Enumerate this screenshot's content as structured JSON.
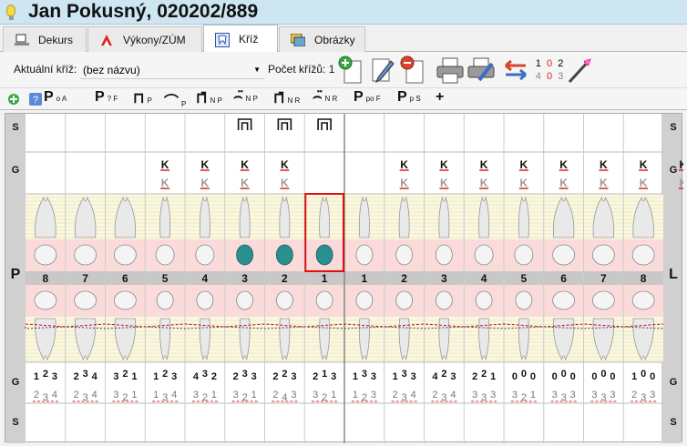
{
  "window": {
    "title": "Jan Pokusný, 020202/889"
  },
  "tabs": [
    {
      "label": "Dekurs",
      "icon": "monitor-icon",
      "active": false
    },
    {
      "label": "Výkony/ZÚM",
      "icon": "procedures-icon",
      "active": false
    },
    {
      "label": "Kříž",
      "icon": "tooth-icon",
      "active": true
    },
    {
      "label": "Obrázky",
      "icon": "pictures-icon",
      "active": false
    }
  ],
  "toolbar": {
    "cross_label": "Aktuální kříž:",
    "cross_value": "(bez názvu)",
    "count_label": "Počet křížů: 1",
    "buttons": [
      "add-cross-icon",
      "edit-cross-icon",
      "delete-cross-icon",
      "print-icon",
      "print-settings-icon",
      "swap-arrows-icon",
      "numbering-icon",
      "wand-icon"
    ],
    "numbering": {
      "top": [
        "1",
        "0",
        "2"
      ],
      "bottom": [
        "4",
        "0",
        "3"
      ]
    }
  },
  "symbols": [
    {
      "glyph": "P",
      "sub": "o A"
    },
    {
      "glyph": "P",
      "sub": "? F"
    },
    {
      "glyph": "⊓",
      "sub": "P"
    },
    {
      "glyph": "⌒",
      "sub": "P"
    },
    {
      "glyph": "⊓̄",
      "sub": "N P"
    },
    {
      "glyph": "⌢̈",
      "sub": "N P"
    },
    {
      "glyph": "⊓̄",
      "sub": "N R"
    },
    {
      "glyph": "⌢̈",
      "sub": "N R"
    },
    {
      "glyph": "P",
      "sub": "po F"
    },
    {
      "glyph": "P",
      "sub": "p S"
    },
    {
      "glyph": "+",
      "sub": ""
    }
  ],
  "chart": {
    "side_labels": {
      "S": "S",
      "G": "G"
    },
    "quadrant_left": "P",
    "quadrant_right": "L",
    "tooth_numbers": [
      "8",
      "7",
      "6",
      "5",
      "4",
      "3",
      "2",
      "1",
      "1",
      "2",
      "3",
      "4",
      "5",
      "6",
      "7",
      "8"
    ],
    "upper_K": [
      false,
      false,
      false,
      true,
      true,
      true,
      true,
      false,
      false,
      true,
      true,
      true,
      true,
      true,
      false,
      true,
      true,
      false,
      false,
      false
    ],
    "upper_K_cols": [
      3,
      4,
      5,
      6,
      9,
      10,
      11,
      12,
      13,
      14,
      15,
      16
    ],
    "bridge_cols": [
      5,
      6,
      7
    ],
    "selected_col": 7,
    "filled_cols": [
      5,
      6,
      7
    ],
    "lower_g1": [
      "1 2 3",
      "2 3 4",
      "3 2 1",
      "1 2 3",
      "4 3 2",
      "2 3 3",
      "2 2 3",
      "2 1 3",
      "1 3 3",
      "1 3 3",
      "4 2 3",
      "2 2 1",
      "0 0 0",
      "0 0 0",
      "0 0 0",
      "1 0 0"
    ],
    "lower_g2": [
      "2 3 4",
      "2 3 4",
      "3 2 1",
      "1 3 4",
      "3 2 1",
      "3 2 1",
      "2 4 3",
      "3 2 1",
      "1 2 3",
      "2 3 4",
      "2 3 4",
      "3 3 3",
      "3 2 1",
      "3 3 3",
      "3 3 3",
      "2 3 3"
    ]
  }
}
